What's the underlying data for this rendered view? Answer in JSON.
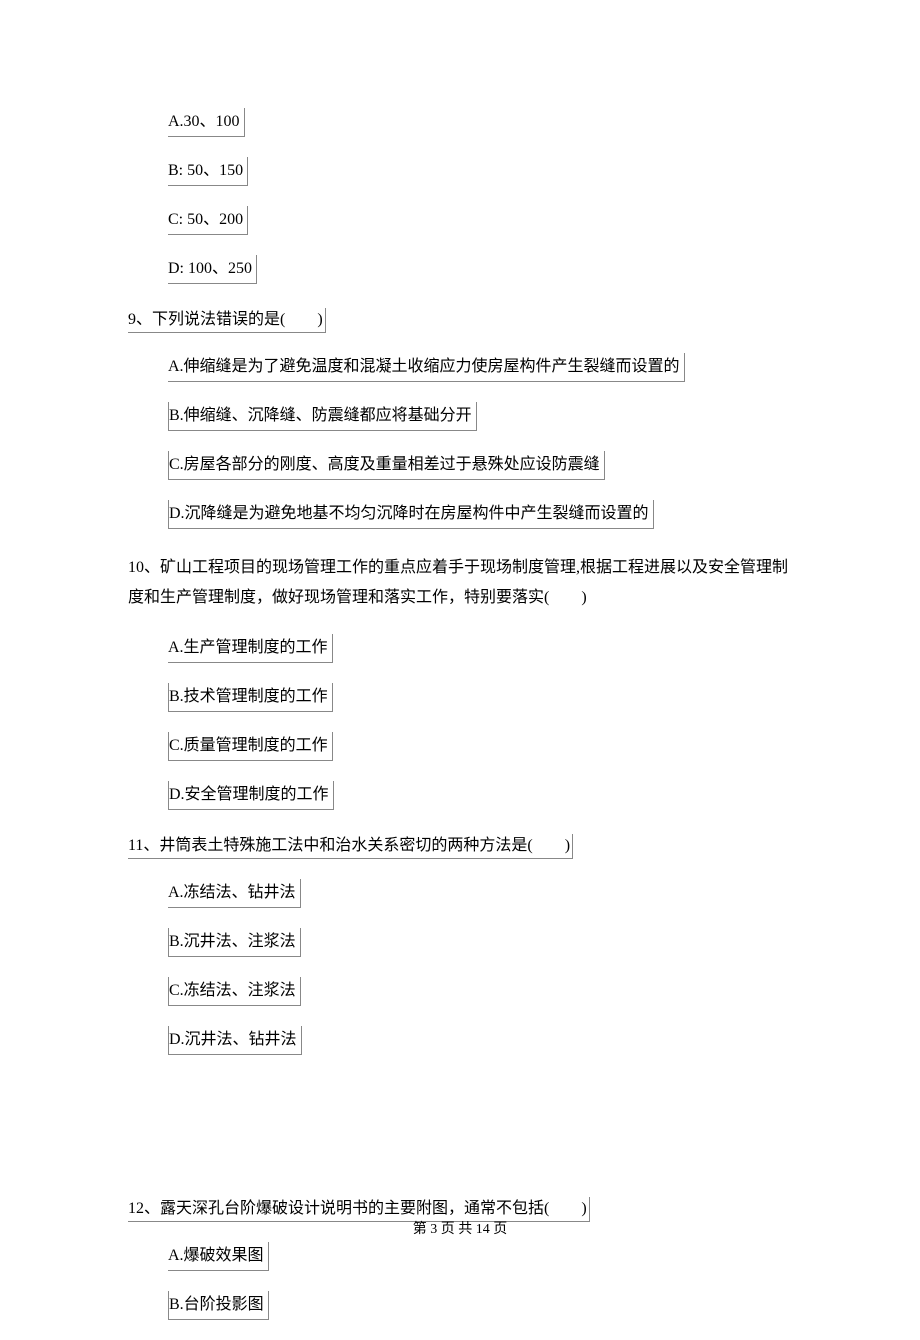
{
  "q8_options": {
    "a": "A.30、100",
    "b": "B: 50、150",
    "c": "C: 50、200",
    "d": "D: 100、250"
  },
  "q9": {
    "stem": "9、下列说法错误的是(　　)",
    "a": "A.伸缩缝是为了避免温度和混凝土收缩应力使房屋构件产生裂缝而设置的",
    "b": "B.伸缩缝、沉降缝、防震缝都应将基础分开",
    "c": "C.房屋各部分的刚度、高度及重量相差过于悬殊处应设防震缝",
    "d": "D.沉降缝是为避免地基不均匀沉降时在房屋构件中产生裂缝而设置的"
  },
  "q10": {
    "stem": "10、矿山工程项目的现场管理工作的重点应着手于现场制度管理,根据工程进展以及安全管理制度和生产管理制度，做好现场管理和落实工作，特别要落实(　　)",
    "a": "A.生产管理制度的工作",
    "b": "B.技术管理制度的工作",
    "c": "C.质量管理制度的工作",
    "d": "D.安全管理制度的工作"
  },
  "q11": {
    "stem": "11、井筒表土特殊施工法中和治水关系密切的两种方法是(　　)",
    "a": "A.冻结法、钻井法",
    "b": "B.沉井法、注浆法",
    "c": "C.冻结法、注浆法",
    "d": "D.沉井法、钻井法"
  },
  "q12": {
    "stem": "12、露天深孔台阶爆破设计说明书的主要附图，通常不包括(　　)",
    "a": "A.爆破效果图",
    "b": "B.台阶投影图"
  },
  "footer": "第 3 页 共 14 页"
}
